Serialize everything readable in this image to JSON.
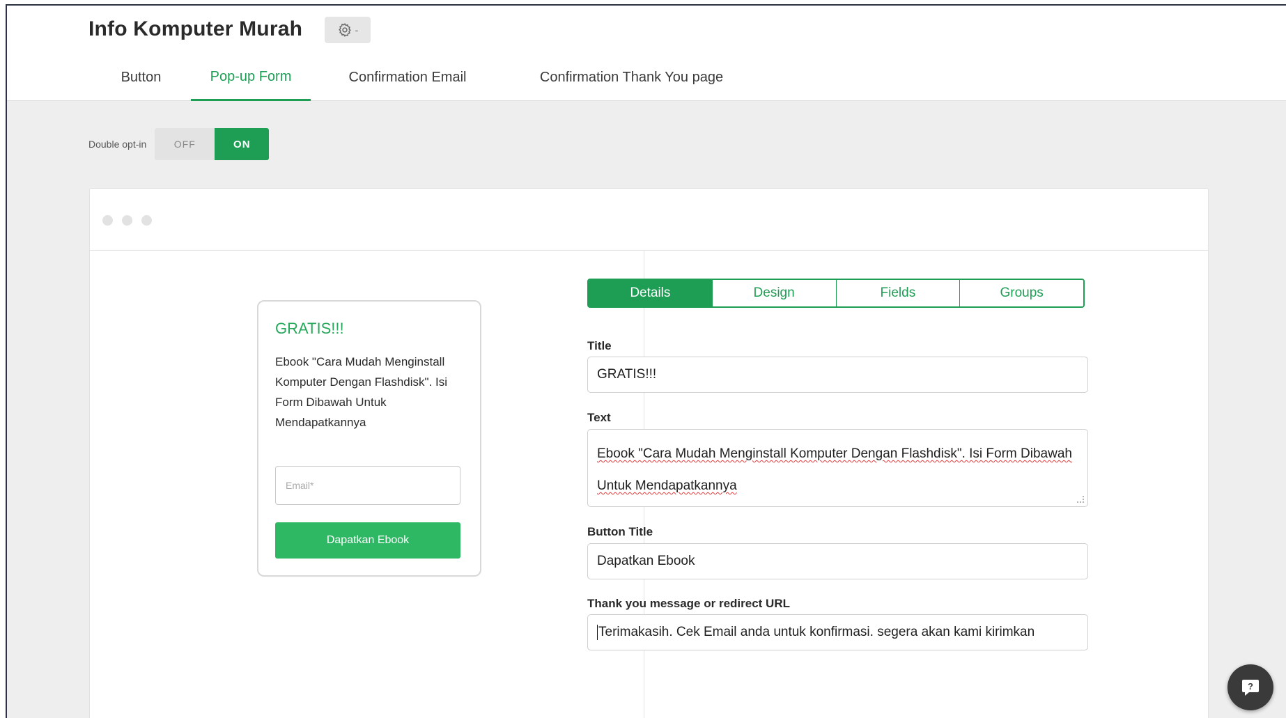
{
  "header": {
    "app_title": "Info Komputer Murah",
    "settings_caret": "-"
  },
  "tabs": [
    {
      "label": "Button",
      "active": false
    },
    {
      "label": "Pop-up Form",
      "active": true
    },
    {
      "label": "Confirmation Email",
      "active": false
    },
    {
      "label": "Confirmation Thank You page",
      "active": false
    }
  ],
  "double_optin": {
    "label": "Double opt-in",
    "off_label": "OFF",
    "on_label": "ON",
    "value": "ON"
  },
  "preview": {
    "title": "GRATIS!!!",
    "text": "Ebook \"Cara Mudah Menginstall Komputer Dengan Flashdisk\". Isi Form Dibawah Untuk Mendapatkannya",
    "email_placeholder": "Email*",
    "button_label": "Dapatkan Ebook"
  },
  "settings_tabs": [
    {
      "label": "Details",
      "active": true
    },
    {
      "label": "Design",
      "active": false
    },
    {
      "label": "Fields",
      "active": false
    },
    {
      "label": "Groups",
      "active": false
    }
  ],
  "form": {
    "title_label": "Title",
    "title_value": "GRATIS!!!",
    "text_label": "Text",
    "text_value": "Ebook \"Cara Mudah Menginstall Komputer Dengan Flashdisk\". Isi Form Dibawah Untuk Mendapatkannya",
    "button_title_label": "Button Title",
    "button_title_value": "Dapatkan Ebook",
    "thankyou_label": "Thank you message or redirect URL",
    "thankyou_value": "Terimakasih. Cek Email anda untuk konfirmasi. segera akan kami kirimkan"
  },
  "colors": {
    "accent": "#1e9e55",
    "preview_button": "#2fb864",
    "background": "#eeeeee"
  },
  "icons": {
    "settings": "gear-icon",
    "help": "help-chat-icon"
  }
}
